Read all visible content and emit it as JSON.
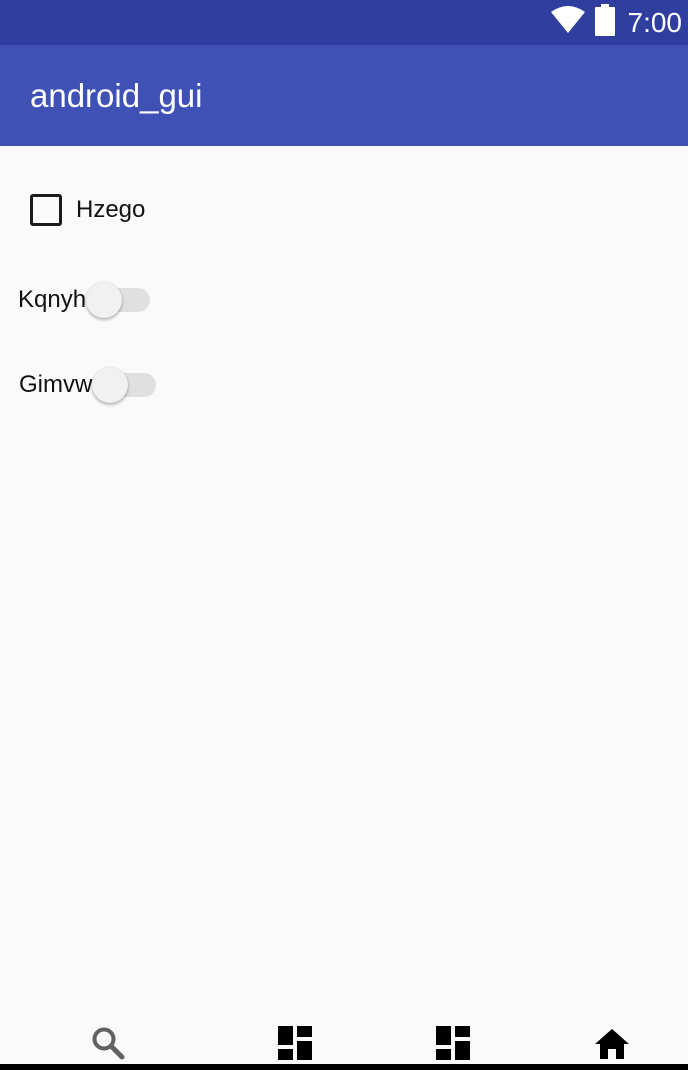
{
  "status_bar": {
    "time": "7:00",
    "icons": [
      "wifi-icon",
      "battery-icon"
    ],
    "color": "#303f9f"
  },
  "app_bar": {
    "title": "android_gui",
    "color": "#3f51b5"
  },
  "content": {
    "checkbox": {
      "label": "Hzego",
      "checked": false
    },
    "switches": [
      {
        "label": "Kqnyh",
        "on": false
      },
      {
        "label": "Gimvw",
        "on": false
      }
    ]
  },
  "bottom_nav": {
    "items": [
      {
        "icon": "search-icon",
        "selected": false
      },
      {
        "icon": "dashboard-icon",
        "selected": false
      },
      {
        "icon": "dashboard-icon",
        "selected": false
      },
      {
        "icon": "home-icon",
        "selected": true
      }
    ]
  }
}
